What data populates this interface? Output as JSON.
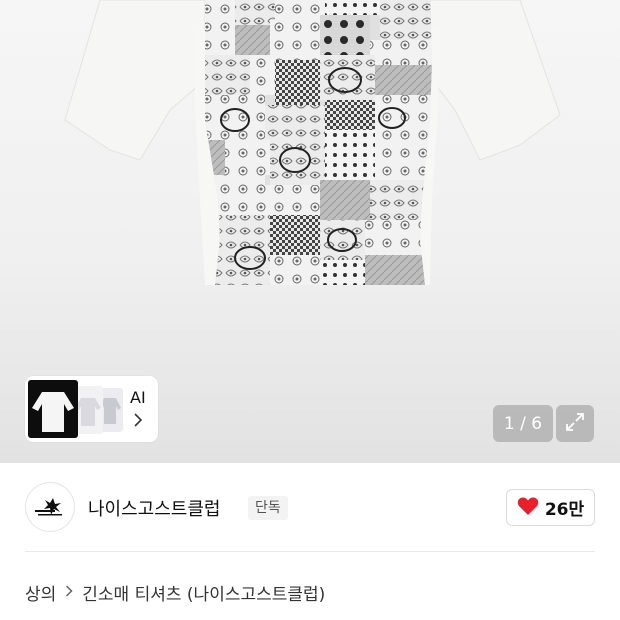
{
  "gallery": {
    "pager_text": "1 / 6",
    "ai_card": {
      "label": "AI"
    }
  },
  "brand": {
    "name": "나이스고스트클럽",
    "badge": "단독"
  },
  "like": {
    "count": "26만",
    "color": "#e8202b"
  },
  "breadcrumb": {
    "category": "상의",
    "product": "긴소매 티셔츠 (나이스고스트클럽)"
  },
  "icons": {
    "expand": "expand-icon",
    "heart": "heart-icon",
    "chevron": "chevron-right-icon"
  }
}
